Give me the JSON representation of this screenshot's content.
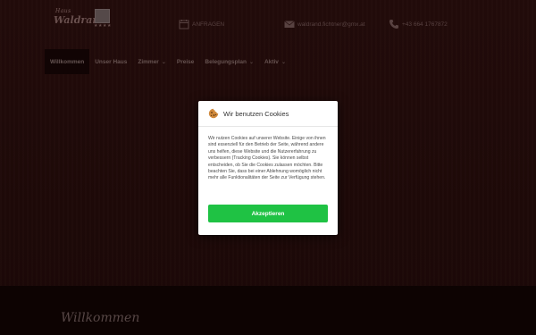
{
  "logo": {
    "small_text": "Haus",
    "brand_text": "Waldrand",
    "stars": "★★★★"
  },
  "contacts": [
    {
      "icon": "calendar-icon",
      "text": "ANFRAGEN"
    },
    {
      "icon": "envelope-icon",
      "text": "waldrand.fichtner@gmx.at"
    },
    {
      "icon": "phone-icon",
      "text": "+43 664 1767872"
    }
  ],
  "nav": {
    "items": [
      {
        "label": "Willkommen",
        "active": true
      },
      {
        "label": "Unser Haus"
      },
      {
        "label": "Zimmer",
        "chevron": true
      },
      {
        "label": "Preise"
      },
      {
        "label": "Belegungsplan",
        "chevron": true
      },
      {
        "label": "Aktiv",
        "chevron": true
      }
    ]
  },
  "main": {
    "heading": "Willkommen"
  },
  "cookie_modal": {
    "icon": "cookie-icon",
    "title": "Wir benutzen Cookies",
    "body": "Wir nutzen Cookies auf unserer Website. Einige von ihnen sind essenziell für den Betrieb der Seite, während andere uns helfen, diese Website und die Nutzererfahrung zu verbessern (Tracking Cookies). Sie können selbst entscheiden, ob Sie die Cookies zulassen möchten. Bitte beachten Sie, dass bei einer Ablehnung womöglich nicht mehr alle Funktionalitäten der Seite zur Verfügung stehen.",
    "accept_label": "Akzeptieren"
  },
  "colors": {
    "accent_green": "#1fc244",
    "background": "#1d0a09"
  }
}
